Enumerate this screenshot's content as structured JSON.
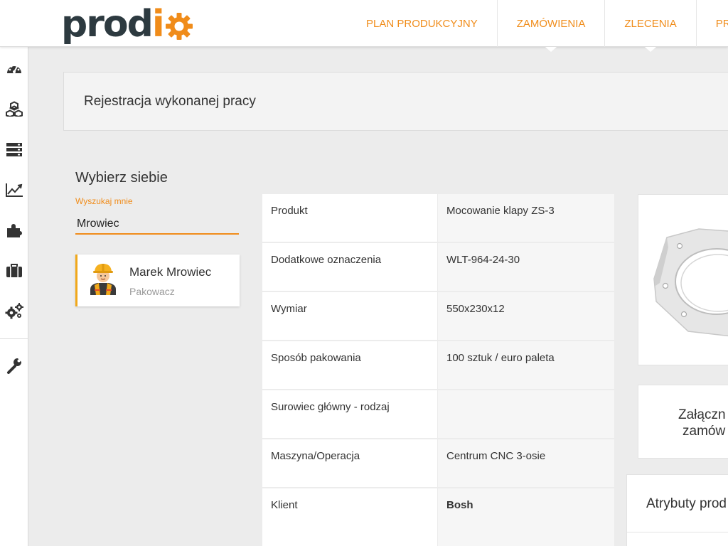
{
  "brand": {
    "logo_part1": "prod",
    "logo_part2": "i",
    "accent_color": "#f08c1a",
    "dark_color": "#2d3a40"
  },
  "nav": {
    "items": [
      {
        "label": "PLAN PRODUKCYJNY"
      },
      {
        "label": "ZAMÓWIENIA"
      },
      {
        "label": "ZLECENIA"
      },
      {
        "label": "PRO"
      }
    ]
  },
  "sidebar": {
    "items": [
      {
        "icon": "dashboard-icon"
      },
      {
        "icon": "cubes-icon"
      },
      {
        "icon": "server-icon"
      },
      {
        "icon": "chart-line-icon"
      },
      {
        "icon": "puzzle-icon"
      },
      {
        "icon": "briefcase-icon"
      },
      {
        "icon": "gears-icon"
      },
      {
        "icon": "wrench-icon"
      }
    ]
  },
  "page": {
    "title": "Rejestracja wykonanej pracy"
  },
  "worker_select": {
    "title": "Wybierz siebie",
    "search_label": "Wyszukaj mnie",
    "search_value": "Mrowiec",
    "result": {
      "name": "Marek Mrowiec",
      "role": "Pakowacz",
      "avatar_icon": "worker-avatar-icon"
    }
  },
  "details": {
    "rows": [
      {
        "label": "Produkt",
        "value": "Mocowanie klapy ZS-3"
      },
      {
        "label": "Dodatkowe oznaczenia",
        "value": "WLT-964-24-30"
      },
      {
        "label": "Wymiar",
        "value": "550x230x12"
      },
      {
        "label": "Sposób pakowania",
        "value": "100 sztuk / euro paleta"
      },
      {
        "label": "Surowiec główny - rodzaj",
        "value": ""
      },
      {
        "label": "Maszyna/Operacja",
        "value": "Centrum CNC 3-osie"
      },
      {
        "label": "Klient",
        "value": "Bosh"
      }
    ]
  },
  "right_panel": {
    "attachment_line1": "Załączn",
    "attachment_line2": "zamów",
    "attributes_title": "Atrybuty prod"
  }
}
